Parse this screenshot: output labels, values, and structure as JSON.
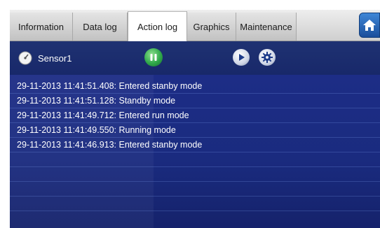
{
  "tabs": [
    {
      "label": "Information",
      "active": false
    },
    {
      "label": "Data log",
      "active": false
    },
    {
      "label": "Action log",
      "active": true
    },
    {
      "label": "Graphics",
      "active": false
    },
    {
      "label": "Maintenance",
      "active": false
    }
  ],
  "home": {
    "icon": "home-icon"
  },
  "toolbar": {
    "sensor_label": "Sensor1",
    "sensor_icon": "gauge-icon",
    "pause_icon": "pause-icon",
    "play_icon": "play-icon",
    "settings_icon": "gear-icon"
  },
  "log": {
    "entries": [
      "29-11-2013 11:41:51.408: Entered stanby mode",
      "29-11-2013 11:41:51.128: Standby mode",
      "29-11-2013 11:41:49.712: Entered run mode",
      "29-11-2013 11:41:49.550: Running mode",
      "29-11-2013 11:41:46.913: Entered stanby mode",
      "",
      "",
      "",
      ""
    ]
  },
  "colors": {
    "background": "#1a2b7f",
    "pause_button": "#2fa84a",
    "accent": "#1a4f9c"
  }
}
